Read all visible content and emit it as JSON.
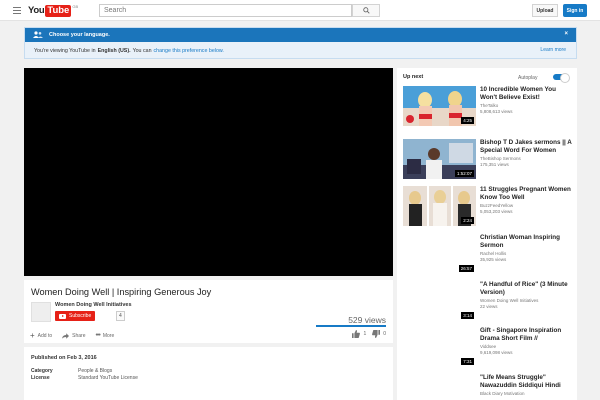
{
  "masthead": {
    "logo_you": "You",
    "logo_tube": "Tube",
    "logo_sup": "GB",
    "search_placeholder": "Search",
    "upload_label": "Upload",
    "signin_label": "Sign in"
  },
  "lang_banner": {
    "heading": "Choose your language.",
    "text_pre": "You're viewing YouTube in",
    "language": "English (US).",
    "text_mid": "You can",
    "link": "change this preference below.",
    "learn_more": "Learn more",
    "close": "×"
  },
  "video": {
    "title": "Women Doing Well | Inspiring Generous Joy",
    "channel": "Women Doing Well Initiatives",
    "subscribe_label": "Subscribe",
    "subscriber_count": "4",
    "views": "529 views",
    "actions": {
      "add": "Add to",
      "share": "Share",
      "more": "More"
    },
    "likes": "1",
    "dislikes": "0"
  },
  "description": {
    "published": "Published on Feb 3, 2016",
    "category_label": "Category",
    "category_value": "People & Blogs",
    "license_label": "License",
    "license_value": "Standard YouTube License"
  },
  "sidebar": {
    "upnext": "Up next",
    "autoplay": "Autoplay",
    "autoplay_on": true,
    "videos": [
      {
        "title": "10 Incredible Women You Won't Believe Exist!",
        "channel": "TheTalko",
        "views": "5,808,613 views",
        "duration": "4:25"
      },
      {
        "title": "Bishop T D Jakes sermons || A Special Word For Women",
        "channel": "TheBishop Sermons",
        "views": "175,351 views",
        "duration": "1:52:07"
      },
      {
        "title": "11 Struggles Pregnant Women Know Too Well",
        "channel": "BuzzFeedYellow",
        "views": "5,053,203 views",
        "duration": "2:24"
      },
      {
        "title": "Christian Woman Inspiring Sermon",
        "channel": "Rachel Hollis",
        "views": "35,925 views",
        "duration": "26:57"
      },
      {
        "title": "\"A Handful of Rice\" (3 Minute Version)",
        "channel": "Women Doing Well Initiatives",
        "views": "22 views",
        "duration": "3:14"
      },
      {
        "title": "Gift - Singapore Inspiration Drama Short Film //",
        "channel": "Viddsee",
        "views": "9,619,098 views",
        "duration": "7:31"
      },
      {
        "title": "\"Life Means Struggle\" Nawazuddin Siddiqui Hindi",
        "channel": "Black Diary Motivation",
        "views": "",
        "duration": ""
      }
    ]
  },
  "colors": {
    "brand_red": "#e62117",
    "link_blue": "#167ac6",
    "banner_blue": "#1b75bb"
  }
}
